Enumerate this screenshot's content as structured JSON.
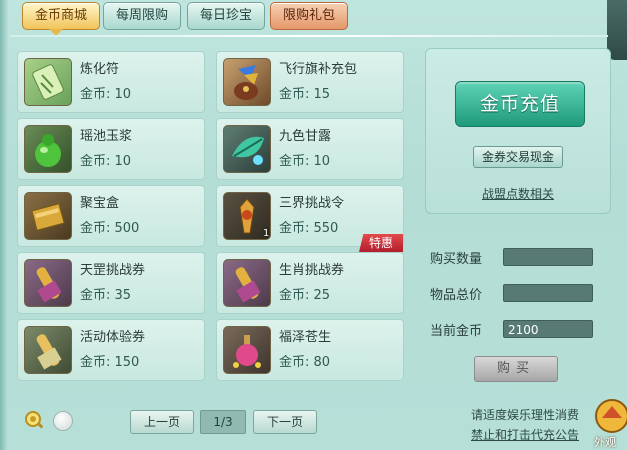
{
  "tabs": [
    {
      "label": "金币商城",
      "state": "active"
    },
    {
      "label": "每周限购",
      "state": "normal"
    },
    {
      "label": "每日珍宝",
      "state": "normal"
    },
    {
      "label": "限购礼包",
      "state": "red"
    }
  ],
  "items": [
    {
      "name": "炼化符",
      "price": "金币: 10",
      "icon": "talisman-icon"
    },
    {
      "name": "飞行旗补充包",
      "price": "金币: 15",
      "icon": "flag-pouch-icon"
    },
    {
      "name": "瑶池玉浆",
      "price": "金币: 10",
      "icon": "jade-gourd-icon"
    },
    {
      "name": "九色甘露",
      "price": "金币: 10",
      "icon": "nectar-leaf-icon"
    },
    {
      "name": "聚宝盒",
      "price": "金币: 500",
      "icon": "treasure-box-icon"
    },
    {
      "name": "三界挑战令",
      "price": "金币: 550",
      "icon": "challenge-token-icon",
      "qty": "1",
      "badge": "特惠"
    },
    {
      "name": "天罡挑战券",
      "price": "金币: 35",
      "icon": "scroll-icon"
    },
    {
      "name": "生肖挑战券",
      "price": "金币: 25",
      "icon": "scroll-icon"
    },
    {
      "name": "活动体验券",
      "price": "金币: 150",
      "icon": "scroll-icon"
    },
    {
      "name": "福泽苍生",
      "price": "金币: 80",
      "icon": "potion-icon"
    }
  ],
  "panel": {
    "recharge": "金币充值",
    "exchange": "金券交易现金",
    "alliance": "战盟点数相关"
  },
  "form": {
    "qty_label": "购买数量",
    "qty_value": "",
    "total_label": "物品总价",
    "total_value": "",
    "coins_label": "当前金币",
    "coins_value": "2100",
    "buy": "购买"
  },
  "pager": {
    "prev": "上一页",
    "page": "1/3",
    "next": "下一页"
  },
  "notice": {
    "line1": "请适度娱乐理性消费",
    "line2": "禁止和打击代充公告"
  },
  "outer": {
    "label": "外观"
  },
  "colors": {
    "accent": "#1f9a7b",
    "active_tab": "#f1c45a",
    "badge": "#c92a38"
  }
}
